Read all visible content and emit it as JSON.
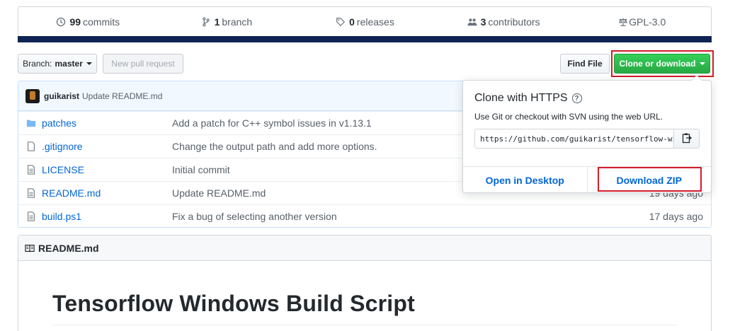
{
  "stats": {
    "commits": {
      "count": "99",
      "label": "commits",
      "icon": "history-icon"
    },
    "branches": {
      "count": "1",
      "label": "branch",
      "icon": "branch-icon"
    },
    "releases": {
      "count": "0",
      "label": "releases",
      "icon": "tag-icon"
    },
    "contributors": {
      "count": "3",
      "label": "contributors",
      "icon": "people-icon"
    },
    "license": {
      "label": "GPL-3.0",
      "icon": "law-icon"
    },
    "language_bar_color": "#0f2452"
  },
  "toolbar": {
    "branch_prefix": "Branch:",
    "branch_name": "master",
    "new_pull_request": "New pull request",
    "find_file": "Find File",
    "clone_or_download": "Clone or download"
  },
  "latest_commit": {
    "author": "guikarist",
    "message": "Update README.md"
  },
  "files": [
    {
      "type": "directory",
      "name": "patches",
      "message": "Add a patch for C++ symbol issues in v1.13.1",
      "age": ""
    },
    {
      "type": "file",
      "name": ".gitignore",
      "message": "Change the output path and add more options.",
      "age": ""
    },
    {
      "type": "file",
      "name": "LICENSE",
      "message": "Initial commit",
      "age": ""
    },
    {
      "type": "file",
      "name": "README.md",
      "message": "Update README.md",
      "age": "19 days ago"
    },
    {
      "type": "file",
      "name": "build.ps1",
      "message": "Fix a bug of selecting another version",
      "age": "17 days ago"
    }
  ],
  "readme": {
    "filename": "README.md",
    "heading": "Tensorflow Windows Build Script"
  },
  "clone_popup": {
    "title": "Clone with HTTPS",
    "help": "?",
    "description": "Use Git or checkout with SVN using the web URL.",
    "url": "https://github.com/guikarist/tensorflow-windows-build-script.git",
    "open_in_desktop": "Open in Desktop",
    "download_zip": "Download ZIP"
  },
  "colors": {
    "accent_green": "#28a745",
    "link_blue": "#0366d6",
    "highlight_red": "#d21c2a"
  }
}
